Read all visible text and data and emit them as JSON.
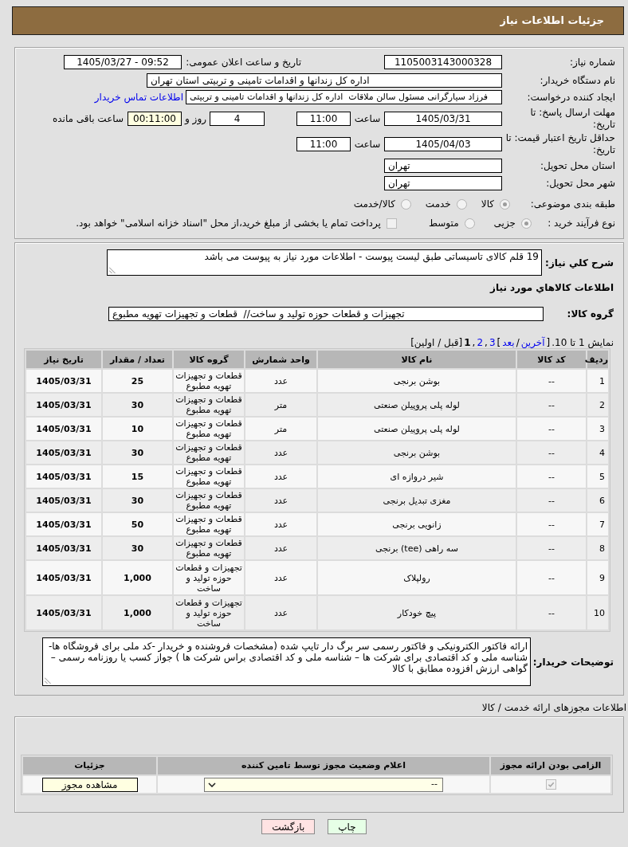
{
  "header": {
    "title": "جزئیات اطلاعات نیاز"
  },
  "details": {
    "need_number": {
      "label": "شماره نیاز:",
      "value": "1105003143000328"
    },
    "announced": {
      "label": "تاریخ و ساعت اعلان عمومی:",
      "value": "1405/03/27 - 09:52"
    },
    "buyer_org": {
      "label": "نام دستگاه خریدار:",
      "value": "اداره کل زندانها و اقدامات تامینی و تربیتی استان تهران"
    },
    "requester": {
      "label": "ایجاد کننده درخواست:",
      "value": "فرزاد سیارگرانی مسئول سالن ملاقات  اداره کل زندانها و اقدامات تامینی و تربیتی",
      "contact_link": "اطلاعات تماس خریدار"
    },
    "reply_deadline": {
      "label": "مهلت ارسال پاسخ: تا تاریخ:",
      "date": "1405/03/31",
      "time_label": "ساعت",
      "time": "11:00",
      "days": "4",
      "days_label": "روز و",
      "remaining": "00:11:00",
      "remaining_label": "ساعت باقی مانده"
    },
    "price_validity": {
      "label": "حداقل تاریخ اعتبار قیمت: تا تاریخ:",
      "date": "1405/04/03",
      "time_label": "ساعت",
      "time": "11:00"
    },
    "delivery_province": {
      "label": "استان محل تحویل:",
      "value": "تهران"
    },
    "delivery_city": {
      "label": "شهر محل تحویل:",
      "value": "تهران"
    },
    "category": {
      "label": "طبقه بندی موضوعی:",
      "disabled": true,
      "options": [
        {
          "label": "کالا",
          "selected": true
        },
        {
          "label": "خدمت",
          "selected": false
        },
        {
          "label": "کالا/خدمت",
          "selected": false
        }
      ]
    },
    "purchase_type": {
      "label": "نوع فرآیند خرید :",
      "disabled": true,
      "options": [
        {
          "label": "جزیی",
          "selected": true
        },
        {
          "label": "متوسط",
          "selected": false
        }
      ],
      "treasury": {
        "label": "پرداخت تمام یا بخشی از مبلغ خرید،از محل \"اسناد خزانه اسلامی\" خواهد بود.",
        "checked": false,
        "disabled": true
      }
    }
  },
  "need_summary": {
    "label": "شرح کلي نیاز:",
    "value": "19 قلم کالای تاسیساتی طبق لیست پیوست - اطلاعات مورد نیاز به پیوست می باشد"
  },
  "goods": {
    "heading": "اطلاعات کالاهاي مورد نیاز",
    "group": {
      "label": "گروه کالا:",
      "value": "تجهیزات و قطعات حوزه تولید و ساخت//  قطعات و تجهیزات تهویه مطبوع"
    },
    "pagination": {
      "items": [
        {
          "kind": "text",
          "text": "نمایش 1 تا 10."
        },
        {
          "kind": "text",
          "text": "["
        },
        {
          "kind": "link",
          "text": "آخرین"
        },
        {
          "kind": "text",
          "text": "/"
        },
        {
          "kind": "link",
          "text": "بعد"
        },
        {
          "kind": "text",
          "text": "]"
        },
        {
          "kind": "link",
          "text": "3"
        },
        {
          "kind": "text",
          "text": ","
        },
        {
          "kind": "link",
          "text": "2"
        },
        {
          "kind": "text",
          "text": ","
        },
        {
          "kind": "current",
          "text": "1"
        },
        {
          "kind": "text",
          "text": "[قبل / اولین]"
        }
      ]
    },
    "table": {
      "columns": [
        "ردیف",
        "کد کالا",
        "نام کالا",
        "واحد شمارش",
        "گروه کالا",
        "تعداد / مقدار",
        "تاریخ نیاز"
      ],
      "rows": [
        [
          "1",
          "--",
          "بوشن برنجی",
          "عدد",
          "قطعات و تجهیزات تهویه مطبوع",
          "25",
          "1405/03/31"
        ],
        [
          "2",
          "--",
          "لوله پلی پروپیلن صنعتی",
          "متر",
          "قطعات و تجهیزات تهویه مطبوع",
          "30",
          "1405/03/31"
        ],
        [
          "3",
          "--",
          "لوله پلی پروپیلن صنعتی",
          "متر",
          "قطعات و تجهیزات تهویه مطبوع",
          "10",
          "1405/03/31"
        ],
        [
          "4",
          "--",
          "بوشن برنجی",
          "عدد",
          "قطعات و تجهیزات تهویه مطبوع",
          "30",
          "1405/03/31"
        ],
        [
          "5",
          "--",
          "شیر دروازه ای",
          "عدد",
          "قطعات و تجهیزات تهویه مطبوع",
          "15",
          "1405/03/31"
        ],
        [
          "6",
          "--",
          "مغزی تبدیل برنجی",
          "عدد",
          "قطعات و تجهیزات تهویه مطبوع",
          "30",
          "1405/03/31"
        ],
        [
          "7",
          "--",
          "زانویی برنجی",
          "عدد",
          "قطعات و تجهیزات تهویه مطبوع",
          "50",
          "1405/03/31"
        ],
        [
          "8",
          "--",
          "سه راهی (tee) برنجی",
          "عدد",
          "قطعات و تجهیزات تهویه مطبوع",
          "30",
          "1405/03/31"
        ],
        [
          "9",
          "--",
          "رولپلاک",
          "عدد",
          "تجهیزات و قطعات حوزه تولید و ساخت",
          "1,000",
          "1405/03/31"
        ],
        [
          "10",
          "--",
          "پیچ خودکار",
          "عدد",
          "تجهیزات و قطعات حوزه تولید و ساخت",
          "1,000",
          "1405/03/31"
        ]
      ]
    }
  },
  "buyer_notes": {
    "label": "توضیحات خریدار:",
    "value": "ارائه فاکتور الکترونیکی و فاکتور رسمی سر برگ دار تایپ شده (مشخصات فروشنده و خریدار -کد ملی برای فروشگاه ها- شناسه ملی و کد اقتصادی برای شرکت ها – شناسه ملی و کد اقتصادی براس شرکت ها ) جواز کسب یا روزنامه رسمی –گواهی ارزش افزوده مطابق با کالا"
  },
  "permits": {
    "heading": "اطلاعات مجوزهای ارائه خدمت / کالا",
    "table": {
      "columns": [
        "الزامی بودن ارائه مجوز",
        "اعلام وضعیت مجوز توسط تامین کننده",
        "جزئیات"
      ],
      "rows": [
        {
          "checked": true,
          "disabled": true,
          "status": "--",
          "button": "مشاهده مجوز"
        }
      ]
    }
  },
  "buttons": [
    {
      "label": "چاپ",
      "kind": "print"
    },
    {
      "label": "بازگشت",
      "kind": "back"
    }
  ]
}
